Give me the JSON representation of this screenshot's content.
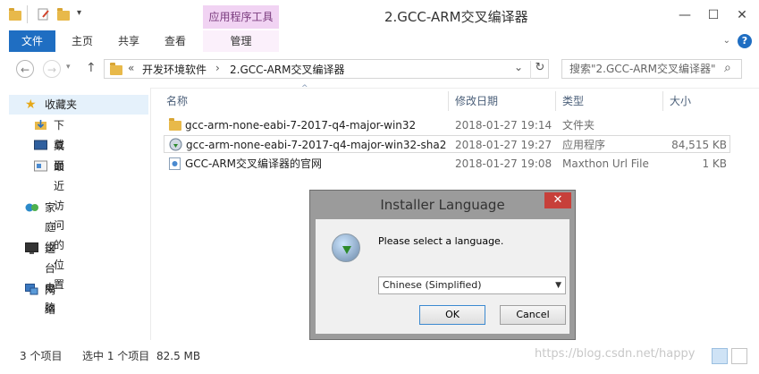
{
  "window": {
    "title": "2.GCC-ARM交叉编译器",
    "context_tab": "应用程序工具",
    "controls": {
      "minimize": "—",
      "maximize": "☐",
      "close": "✕"
    }
  },
  "ribbon": {
    "tabs": [
      "文件",
      "主页",
      "共享",
      "查看",
      "管理"
    ],
    "help": "?"
  },
  "address": {
    "back": "←",
    "forward": "→",
    "up": "↑",
    "prefix": "«",
    "segments": [
      "开发环境软件",
      "2.GCC-ARM交叉编译器"
    ],
    "separator": "›",
    "dropdown": "⌄",
    "refresh": "↻",
    "search_placeholder": "搜索\"2.GCC-ARM交叉编译器\"",
    "search_icon": "⌕"
  },
  "nav": {
    "favorites": "收藏夹",
    "downloads": "下载",
    "desktop": "桌面",
    "recent": "最近访问的位置",
    "homegroup": "家庭组",
    "this_pc": "这台电脑",
    "network": "网络"
  },
  "columns": {
    "name": "名称",
    "modified": "修改日期",
    "type": "类型",
    "size": "大小"
  },
  "files": [
    {
      "name": "gcc-arm-none-eabi-7-2017-q4-major-win32",
      "modified": "2018-01-27 19:14",
      "type": "文件夹",
      "size": ""
    },
    {
      "name": "gcc-arm-none-eabi-7-2017-q4-major-win32-sha2",
      "modified": "2018-01-27 19:27",
      "type": "应用程序",
      "size": "84,515 KB"
    },
    {
      "name": "GCC-ARM交叉编译器的官网",
      "modified": "2018-01-27 19:08",
      "type": "Maxthon Url File",
      "size": "1 KB"
    }
  ],
  "status": {
    "count": "3 个项目",
    "selected": "选中 1 个项目",
    "selected_size": "82.5 MB"
  },
  "dialog": {
    "title": "Installer Language",
    "close": "✕",
    "message": "Please select a language.",
    "selected_language": "Chinese (Simplified)",
    "ok": "OK",
    "cancel": "Cancel"
  },
  "watermark": "https://blog.csdn.net/happy",
  "colors": {
    "accent": "#1f6ec2",
    "context_tab": "#f1d3f3",
    "close_red": "#c7403a"
  }
}
